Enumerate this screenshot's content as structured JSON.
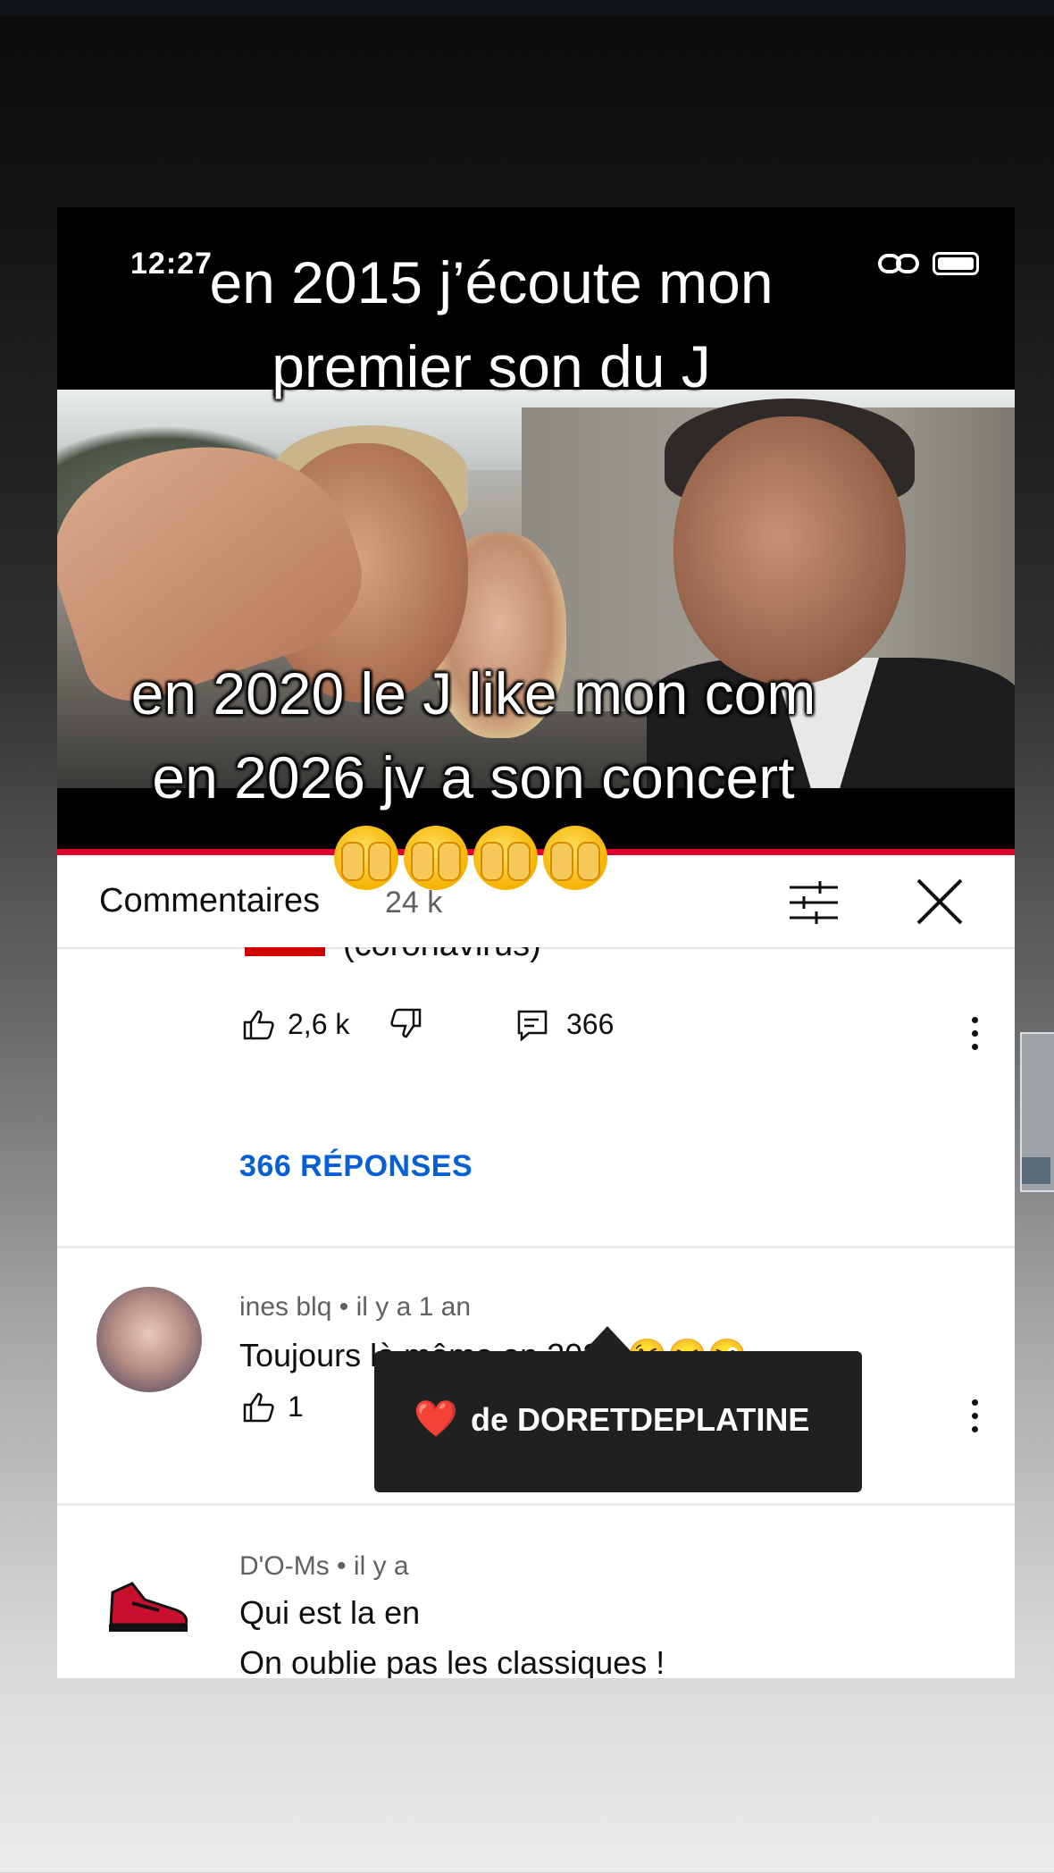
{
  "overlay": {
    "line1": "en 2015 j’écoute mon",
    "line2": "premier son du J",
    "line3": "en 2020 le J like mon com",
    "line4": "en 2026 jv a son concert",
    "emoji_count": 4,
    "emoji_icon": "face-with-hand-over-mouth-icon"
  },
  "status_bar": {
    "time": "12:27"
  },
  "comments": {
    "title": "Commentaires",
    "count": "24 k"
  },
  "top_comment": {
    "partial_text": "(coronavirus)",
    "likes": "2,6 k",
    "reply_count": "366",
    "replies_link": "366 RÉPONSES"
  },
  "comment_2": {
    "author": "ines blq",
    "time": "il y a 1 an",
    "text": "Toujours là même en 2020 😘😝😜",
    "likes": "1"
  },
  "comment_3": {
    "author": "D'O-Ms",
    "time": "il y a",
    "text_line1": "Qui est la en",
    "text_line2": "On oublie pas les classiques !"
  },
  "tooltip": {
    "heart": "❤️",
    "text": "de DORETDEPLATINE"
  },
  "colors": {
    "link_blue": "#065fd4",
    "youtube_red": "#e1002d",
    "heart_red": "#e0002a"
  }
}
